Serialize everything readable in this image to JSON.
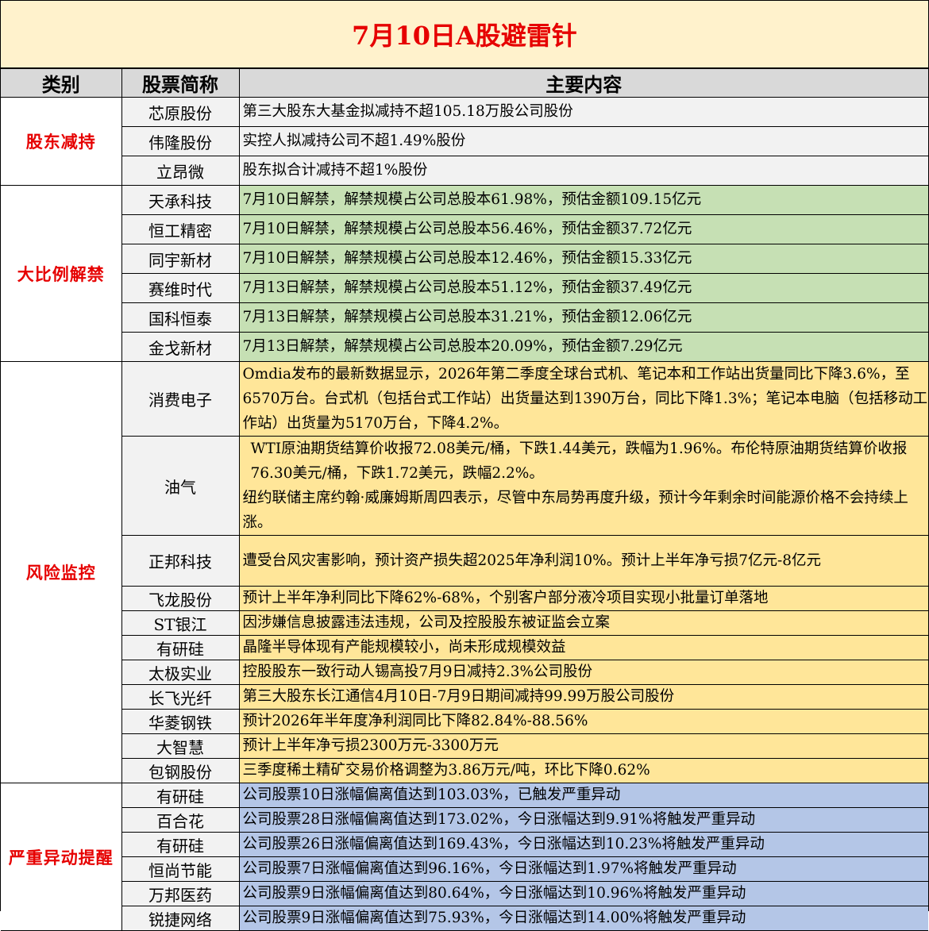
{
  "title": "7月10日A股避雷针",
  "headers": {
    "category": "类别",
    "stock": "股票简称",
    "content": "主要内容"
  },
  "groups": [
    {
      "category": "股东减持",
      "class": "grp-holder",
      "rows": [
        {
          "stock": "芯原股份",
          "content": "第三大股东大基金拟减持不超105.18万股公司股份"
        },
        {
          "stock": "伟隆股份",
          "content": "实控人拟减持公司不超1.49%股份"
        },
        {
          "stock": "立昂微",
          "content": "股东拟合计减持不超1%股份"
        }
      ]
    },
    {
      "category": "大比例解禁",
      "class": "grp-unlock",
      "rows": [
        {
          "stock": "天承科技",
          "content": "7月10日解禁，解禁规模占公司总股本61.98%，预估金额109.15亿元"
        },
        {
          "stock": "恒工精密",
          "content": "7月10日解禁，解禁规模占公司总股本56.46%，预估金额37.72亿元"
        },
        {
          "stock": "同宇新材",
          "content": "7月10日解禁，解禁规模占公司总股本12.46%，预估金额15.33亿元"
        },
        {
          "stock": "赛维时代",
          "content": "7月13日解禁，解禁规模占公司总股本51.12%，预估金额37.49亿元"
        },
        {
          "stock": "国科恒泰",
          "content": "7月13日解禁，解禁规模占公司总股本31.21%，预估金额12.06亿元"
        },
        {
          "stock": "金戈新材",
          "content": "7月13日解禁，解禁规模占公司总股本20.09%，预估金额7.29亿元"
        }
      ]
    },
    {
      "category": "风险监控",
      "class": "grp-risk",
      "rows": [
        {
          "stock": "消费电子",
          "content": "Omdia发布的最新数据显示，2026年第二季度全球台式机、笔记本和工作站出货量同比下降3.6%，至6570万台。台式机（包括台式工作站）出货量达到1390万台，同比下降1.3%；笔记本电脑（包括移动工作站）出货量为5170万台，下降4.2%。"
        },
        {
          "stock": "油气",
          "content": "WTI原油期货结算价收报72.08美元/桶，下跌1.44美元，跌幅为1.96%。布伦特原油期货结算价收报76.30美元/桶，下跌1.72美元，跌幅2.2%。",
          "content2": "纽约联储主席约翰·威廉姆斯周四表示，尽管中东局势再度升级，预计今年剩余时间能源价格不会持续上涨。"
        },
        {
          "stock": "正邦科技",
          "content": "遭受台风灾害影响，预计资产损失超2025年净利润10%。预计上半年净亏损7亿元-8亿元"
        },
        {
          "stock": "飞龙股份",
          "content": "预计上半年净利同比下降62%-68%，个别客户部分液冷项目实现小批量订单落地"
        },
        {
          "stock": "ST银江",
          "content": "因涉嫌信息披露违法违规，公司及控股股东被证监会立案"
        },
        {
          "stock": "有研硅",
          "content": "晶隆半导体现有产能规模较小，尚未形成规模效益"
        },
        {
          "stock": "太极实业",
          "content": "控股股东一致行动人锡高投7月9日减持2.3%公司股份"
        },
        {
          "stock": "长飞光纤",
          "content": "第三大股东长江通信4月10日-7月9日期间减持99.99万股公司股份"
        },
        {
          "stock": "华菱钢铁",
          "content": "预计2026年半年度净利润同比下降82.84%-88.56%"
        },
        {
          "stock": "大智慧",
          "content": "预计上半年净亏损2300万元-3300万元"
        },
        {
          "stock": "包钢股份",
          "content": "三季度稀土精矿交易价格调整为3.86万元/吨，环比下降0.62%"
        }
      ]
    },
    {
      "category": "严重异动提醒",
      "class": "grp-abn",
      "rows": [
        {
          "stock": "有研硅",
          "content": "公司股票10日涨幅偏离值达到103.03%，已触发严重异动"
        },
        {
          "stock": "百合花",
          "content": "公司股票28日涨幅偏离值达到173.02%，今日涨幅达到9.91%将触发严重异动"
        },
        {
          "stock": "有研硅",
          "content": "公司股票26日涨幅偏离值达到169.43%，今日涨幅达到10.23%将触发严重异动"
        },
        {
          "stock": "恒尚节能",
          "content": "公司股票7日涨幅偏离值达到96.16%，今日涨幅达到1.97%将触发严重异动"
        },
        {
          "stock": "万邦医药",
          "content": "公司股票9日涨幅偏离值达到80.64%，今日涨幅达到10.96%将触发严重异动"
        },
        {
          "stock": "锐捷网络",
          "content": "公司股票9日涨幅偏离值达到75.93%，今日涨幅达到14.00%将触发严重异动"
        }
      ]
    }
  ],
  "colors": {
    "title_bg": "#fff2cc",
    "accent_red": "#e60000",
    "header_bg": "#d9d9d9",
    "name_bg": "#f2f2f2",
    "unlock_bg": "#c6e0b4",
    "risk_bg": "#ffe699",
    "abnormal_bg": "#b4c6e7"
  }
}
